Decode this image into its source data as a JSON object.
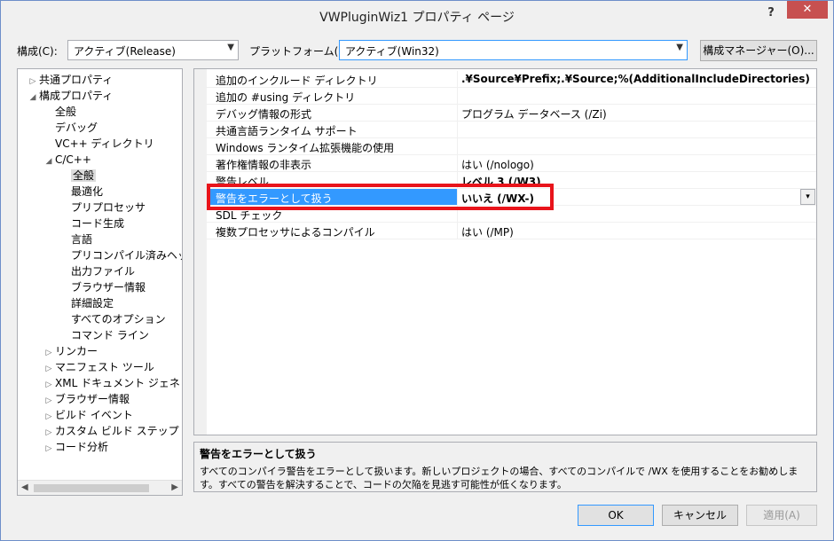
{
  "window": {
    "title": "VWPluginWiz1 プロパティ ページ",
    "help": "?",
    "close": "✕"
  },
  "toolbar": {
    "config_label": "構成(C):",
    "config_value": "アクティブ(Release)",
    "platform_label": "プラットフォーム(P):",
    "platform_value": "アクティブ(Win32)",
    "config_manager": "構成マネージャー(O)..."
  },
  "tree": [
    {
      "label": "共通プロパティ",
      "expander": "▷",
      "level": 0
    },
    {
      "label": "構成プロパティ",
      "expander": "◢",
      "level": 0
    },
    {
      "label": "全般",
      "expander": "",
      "level": 1
    },
    {
      "label": "デバッグ",
      "expander": "",
      "level": 1
    },
    {
      "label": "VC++ ディレクトリ",
      "expander": "",
      "level": 1
    },
    {
      "label": "C/C++",
      "expander": "◢",
      "level": 1
    },
    {
      "label": "全般",
      "expander": "",
      "level": 2,
      "selected": true
    },
    {
      "label": "最適化",
      "expander": "",
      "level": 2
    },
    {
      "label": "プリプロセッサ",
      "expander": "",
      "level": 2
    },
    {
      "label": "コード生成",
      "expander": "",
      "level": 2
    },
    {
      "label": "言語",
      "expander": "",
      "level": 2
    },
    {
      "label": "プリコンパイル済みヘッダー",
      "expander": "",
      "level": 2
    },
    {
      "label": "出力ファイル",
      "expander": "",
      "level": 2
    },
    {
      "label": "ブラウザー情報",
      "expander": "",
      "level": 2
    },
    {
      "label": "詳細設定",
      "expander": "",
      "level": 2
    },
    {
      "label": "すべてのオプション",
      "expander": "",
      "level": 2
    },
    {
      "label": "コマンド ライン",
      "expander": "",
      "level": 2
    },
    {
      "label": "リンカー",
      "expander": "▷",
      "level": 1
    },
    {
      "label": "マニフェスト ツール",
      "expander": "▷",
      "level": 1
    },
    {
      "label": "XML ドキュメント ジェネレータ",
      "expander": "▷",
      "level": 1
    },
    {
      "label": "ブラウザー情報",
      "expander": "▷",
      "level": 1
    },
    {
      "label": "ビルド イベント",
      "expander": "▷",
      "level": 1
    },
    {
      "label": "カスタム ビルド ステップ",
      "expander": "▷",
      "level": 1
    },
    {
      "label": "コード分析",
      "expander": "▷",
      "level": 1
    }
  ],
  "scroll": {
    "left": "◀",
    "right": "▶"
  },
  "properties": [
    {
      "name": "追加のインクルード ディレクトリ",
      "value": ".¥Source¥Prefix;.¥Source;%(AdditionalIncludeDirectories)",
      "bold": true
    },
    {
      "name": "追加の #using ディレクトリ",
      "value": ""
    },
    {
      "name": "デバッグ情報の形式",
      "value": "プログラム データベース (/Zi)"
    },
    {
      "name": "共通言語ランタイム サポート",
      "value": ""
    },
    {
      "name": "Windows ランタイム拡張機能の使用",
      "value": ""
    },
    {
      "name": "著作権情報の非表示",
      "value": "はい (/nologo)"
    },
    {
      "name": "警告レベル",
      "value": "レベル 3 (/W3)",
      "bold": true
    },
    {
      "name": "警告をエラーとして扱う",
      "value": "いいえ (/WX-)",
      "selected": true
    },
    {
      "name": "SDL チェック",
      "value": ""
    },
    {
      "name": "複数プロセッサによるコンパイル",
      "value": "はい (/MP)"
    }
  ],
  "description": {
    "title": "警告をエラーとして扱う",
    "text": "すべてのコンパイラ警告をエラーとして扱います。新しいプロジェクトの場合、すべてのコンパイルで /WX を使用することをお勧めします。すべての警告を解決することで、コードの欠陥を見逃す可能性が低くなります。"
  },
  "buttons": {
    "ok": "OK",
    "cancel": "キャンセル",
    "apply": "適用(A)"
  },
  "icons": {
    "dropdown": "▾",
    "combo_arrow": "⌄"
  }
}
